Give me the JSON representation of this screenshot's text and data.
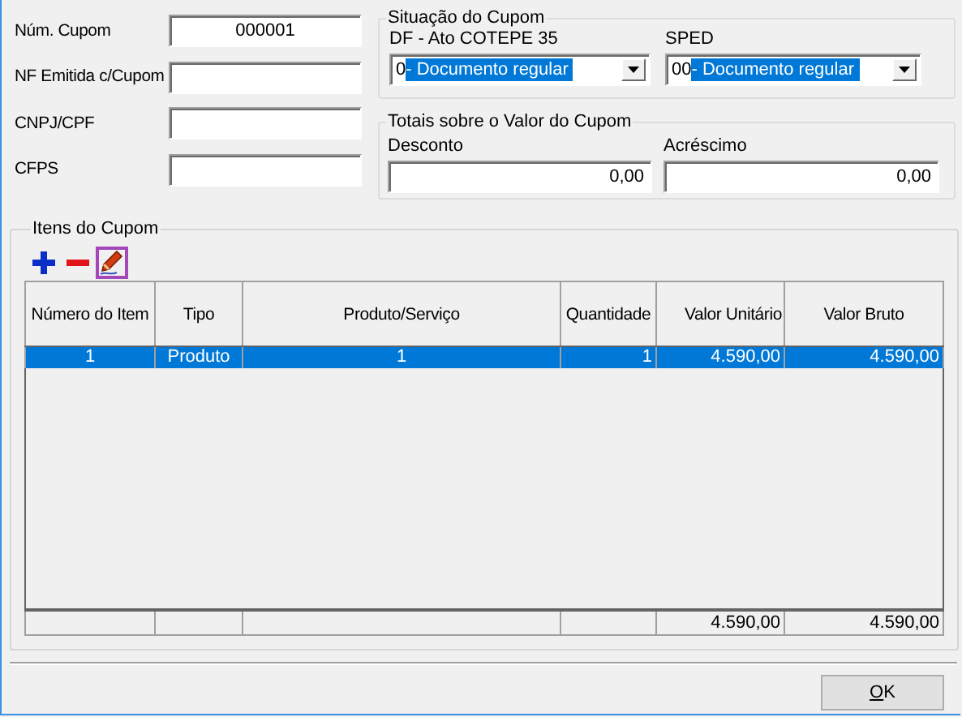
{
  "fields": [
    {
      "label": "Núm. Cupom",
      "value": "000001"
    },
    {
      "label": "NF Emitida c/Cupom"
    },
    {
      "label": "CNPJ/CPF"
    },
    {
      "label": "CFPS"
    }
  ],
  "situacao": {
    "title": "Situação do Cupom",
    "selects": [
      {
        "label": "DF - Ato COTEPE 35",
        "code": "0",
        "text": "- Documento regular",
        "highlighted": true
      },
      {
        "label": "SPED",
        "code": "00",
        "text": "- Documento regular",
        "highlighted": true
      }
    ]
  },
  "totais": {
    "title": "Totais sobre o Valor do Cupom",
    "fields": [
      {
        "label": "Desconto",
        "value": "0,00"
      },
      {
        "label": "Acréscimo",
        "value": "0,00"
      }
    ]
  },
  "itens": {
    "title": "Itens do Cupom",
    "tools": [
      {
        "kind": "add",
        "highlighted": false
      },
      {
        "kind": "remove",
        "highlighted": false
      },
      {
        "kind": "edit",
        "highlighted": true
      }
    ],
    "columns": [
      "Número do Item",
      "Tipo",
      "Produto/Serviço",
      "Quantidade",
      "Valor Unitário",
      "Valor Bruto"
    ],
    "rows": [
      {
        "cells": [
          "1",
          "Produto",
          "1",
          "1",
          "4.590,00",
          "4.590,00"
        ],
        "selected": true
      }
    ],
    "footer": [
      "4.590,00",
      "4.590,00"
    ]
  },
  "ok_button": {
    "label": "OK"
  }
}
